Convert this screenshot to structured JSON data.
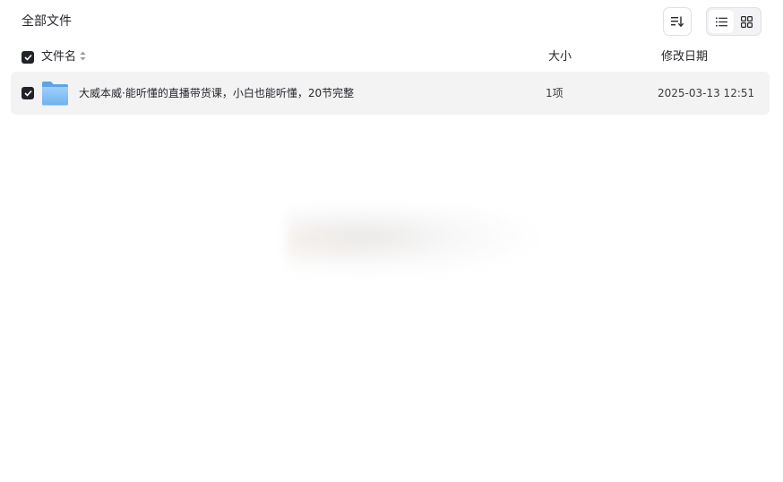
{
  "topbar": {
    "title": "全部文件",
    "sort_icon": "sort-list-icon",
    "view_options": [
      {
        "name": "list-view",
        "icon": "list-icon",
        "active": true
      },
      {
        "name": "grid-view",
        "icon": "grid-icon",
        "active": false
      }
    ]
  },
  "table": {
    "headers": {
      "name": "文件名",
      "size": "大小",
      "date": "修改日期"
    },
    "rows": [
      {
        "icon": "folder-icon",
        "name": "大威本威·能听懂的直播带货课，小白也能听懂，20节完整",
        "size": "1项",
        "date": "2025-03-13 12:51",
        "checked": true
      }
    ]
  },
  "colors": {
    "checkbox": "#222328",
    "row_bg": "#f3f3f4",
    "folder_blue": "#7db9f2"
  }
}
